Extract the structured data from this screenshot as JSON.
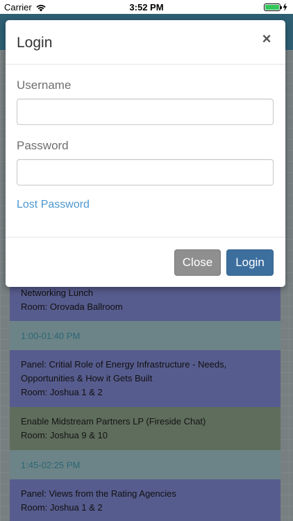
{
  "status_bar": {
    "carrier": "Carrier",
    "time": "3:52 PM",
    "battery_level": 1.0,
    "wifi_icon": "wifi-icon",
    "charging_icon": "bolt-icon"
  },
  "schedule": {
    "rows": [
      {
        "type": "session",
        "lines": [
          "Networking Lunch",
          "Room: Orovada Ballroom"
        ]
      },
      {
        "type": "time",
        "lines": [
          "1:00-01:40 PM"
        ]
      },
      {
        "type": "session",
        "lines": [
          "Panel: Critial Role of Energy Infrastructure - Needs,",
          "Opportunities & How it Gets Built",
          "Room: Joshua 1 & 2"
        ]
      },
      {
        "type": "sessionb",
        "lines": [
          "Enable Midstream Partners LP (Fireside Chat)",
          "Room: Joshua 9 & 10"
        ]
      },
      {
        "type": "time",
        "lines": [
          "1:45-02:25 PM"
        ]
      },
      {
        "type": "session",
        "lines": [
          "Panel: Views from the Rating Agencies",
          "Room: Joshua 1 & 2"
        ]
      }
    ]
  },
  "modal": {
    "title": "Login",
    "close_icon": "×",
    "username_label": "Username",
    "username_value": "",
    "password_label": "Password",
    "password_value": "",
    "lost_password": "Lost Password",
    "close_button": "Close",
    "login_button": "Login"
  }
}
